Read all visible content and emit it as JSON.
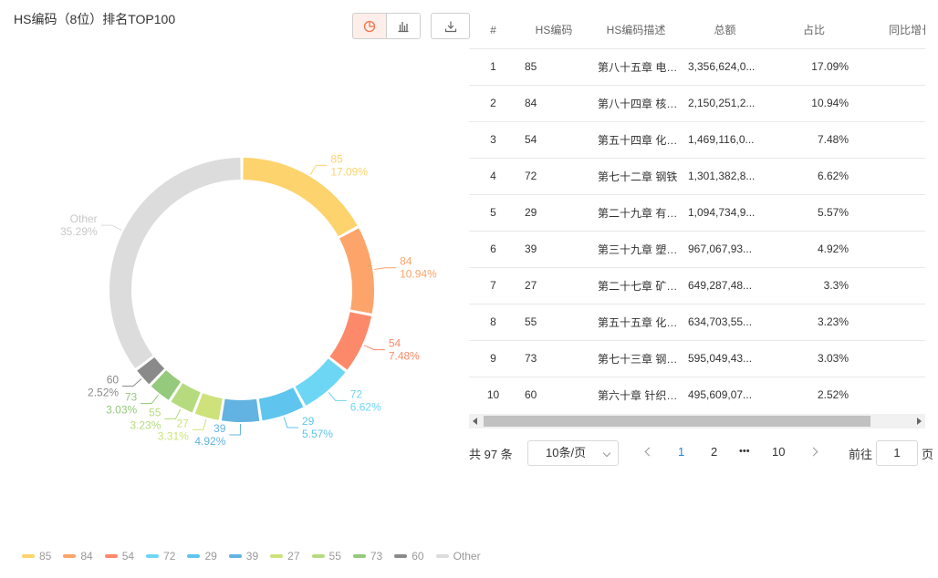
{
  "title": "HS编码（8位）排名TOP100",
  "toolbar": {
    "pie_icon": "pie-chart-icon",
    "bar_icon": "bar-chart-icon",
    "download_icon": "download-icon",
    "accent": "#f07650"
  },
  "chart_data": {
    "type": "pie",
    "variant": "donut",
    "categories": [
      "85",
      "84",
      "54",
      "72",
      "29",
      "39",
      "27",
      "55",
      "73",
      "60",
      "Other"
    ],
    "values": [
      17.09,
      10.94,
      7.48,
      6.62,
      5.57,
      4.92,
      3.31,
      3.23,
      3.03,
      2.52,
      35.29
    ],
    "labels": [
      "17.09%",
      "10.94%",
      "7.48%",
      "6.62%",
      "5.57%",
      "4.92%",
      "3.31%",
      "3.23%",
      "3.03%",
      "2.52%",
      "35.29%"
    ],
    "colors": [
      "#fdd36d",
      "#fca46a",
      "#fc8a6a",
      "#6ed6f5",
      "#5fc5ef",
      "#62b3e1",
      "#cde27a",
      "#b6db7f",
      "#95c97b",
      "#8a8a8a",
      "#dcdcdc"
    ],
    "legend_position": "bottom-left"
  },
  "table": {
    "headers": [
      "#",
      "HS编码",
      "HS编码描述",
      "总额",
      "占比",
      "同比增长"
    ],
    "rows": [
      [
        "1",
        "85",
        "第八十五章 电机、电气设备及其零件",
        "3,356,624,0...",
        "17.09%"
      ],
      [
        "2",
        "84",
        "第八十四章 核反应堆、锅炉、机器",
        "2,150,251,2...",
        "10.94%"
      ],
      [
        "3",
        "54",
        "第五十四章 化学纤维长丝",
        "1,469,116,0...",
        "7.48%"
      ],
      [
        "4",
        "72",
        "第七十二章 钢铁",
        "1,301,382,8...",
        "6.62%"
      ],
      [
        "5",
        "29",
        "第二十九章 有机化学品",
        "1,094,734,9...",
        "5.57%"
      ],
      [
        "6",
        "39",
        "第三十九章 塑料及其制品",
        "967,067,93...",
        "4.92%"
      ],
      [
        "7",
        "27",
        "第二十七章 矿物燃料、矿物油",
        "649,287,48...",
        "3.3%"
      ],
      [
        "8",
        "55",
        "第五十五章 化学纤维短纤",
        "634,703,55...",
        "3.23%"
      ],
      [
        "9",
        "73",
        "第七十三章 钢铁制品",
        "595,049,43...",
        "3.03%"
      ],
      [
        "10",
        "60",
        "第六十章 针织物及钩编织物",
        "495,609,07...",
        "2.52%"
      ]
    ]
  },
  "pagination": {
    "total": "共 97 条",
    "page_size": "10条/页",
    "pages": [
      "1",
      "2",
      "•••",
      "10"
    ],
    "current": "1",
    "goto_label": "前往",
    "goto_value": "1",
    "goto_tail": "页"
  }
}
